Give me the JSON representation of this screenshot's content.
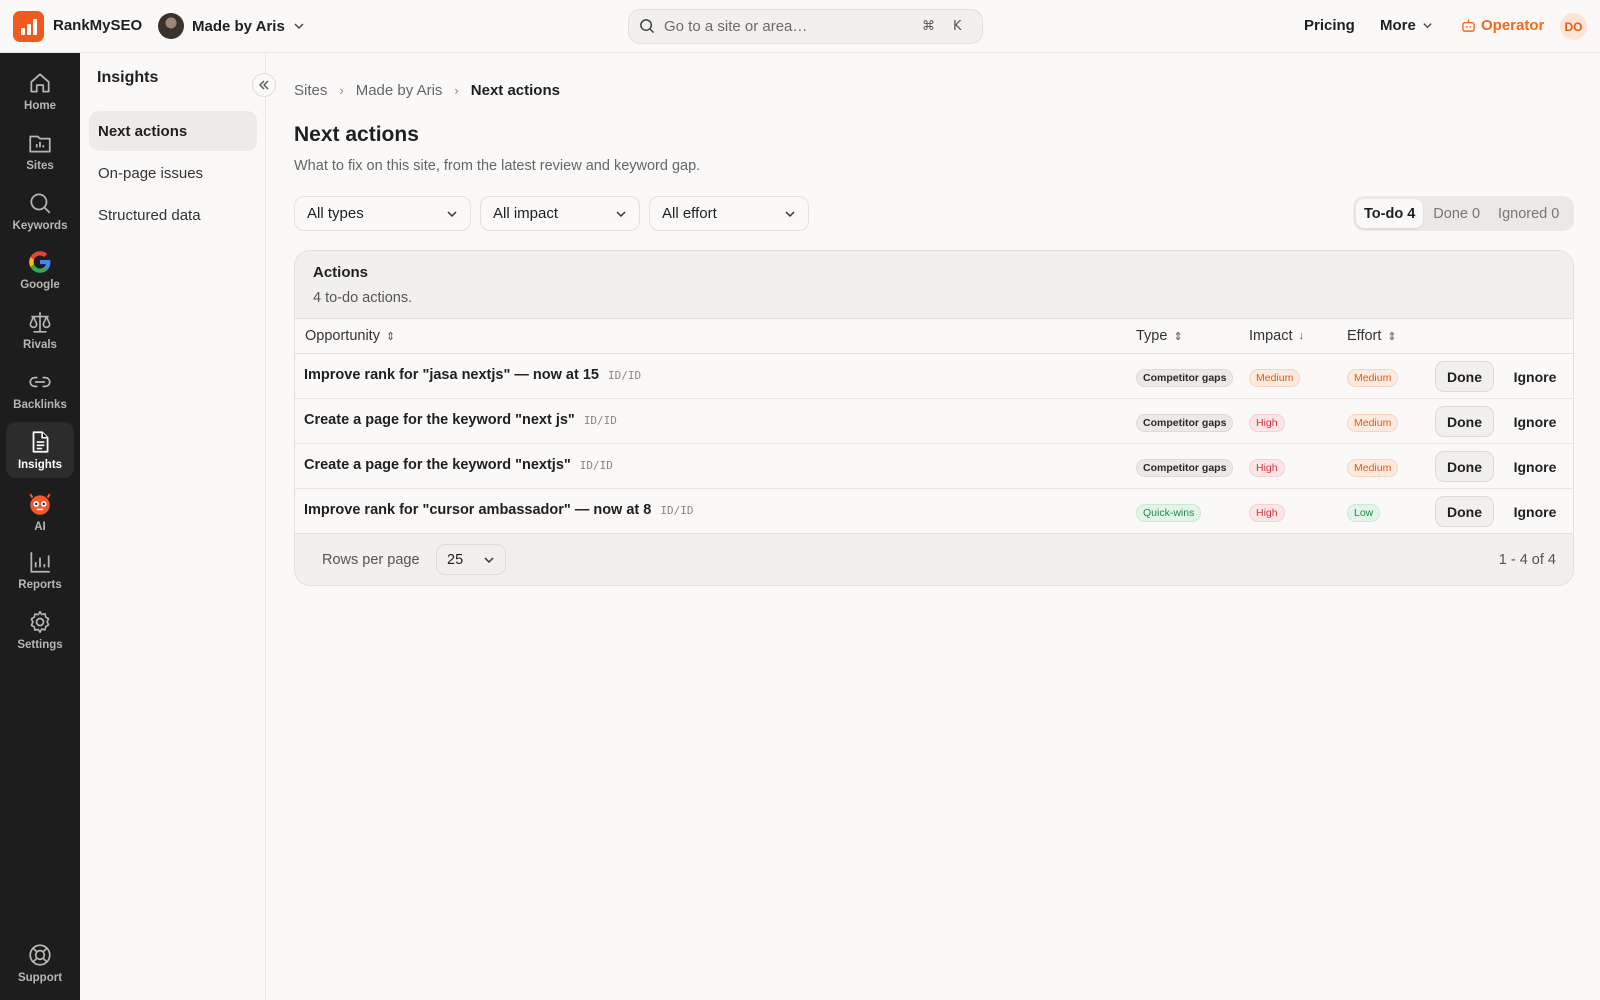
{
  "app": {
    "brand": "RankMySEO",
    "site": "Made by Aris",
    "search_placeholder": "Go to a site or area…",
    "shortcut_cmd": "⌘",
    "shortcut_key": "K",
    "nav_links": {
      "pricing": "Pricing",
      "more": "More",
      "operator": "Operator"
    },
    "user_initials": "DO",
    "colors": {
      "accent": "#f05a1e",
      "rail_bg": "#1d1d1d"
    }
  },
  "rail": {
    "items": [
      {
        "label": "Home",
        "icon": "home-icon"
      },
      {
        "label": "Sites",
        "icon": "sites-icon"
      },
      {
        "label": "Keywords",
        "icon": "search-icon"
      },
      {
        "label": "Google",
        "icon": "google-icon"
      },
      {
        "label": "Rivals",
        "icon": "scale-icon"
      },
      {
        "label": "Backlinks",
        "icon": "link-icon"
      },
      {
        "label": "Insights",
        "icon": "document-icon",
        "active": true
      },
      {
        "label": "AI",
        "icon": "robot-icon"
      },
      {
        "label": "Reports",
        "icon": "bar-chart-icon"
      },
      {
        "label": "Settings",
        "icon": "gear-icon"
      }
    ],
    "support": "Support"
  },
  "subnav": {
    "title": "Insights",
    "items": [
      {
        "label": "Next actions",
        "active": true
      },
      {
        "label": "On-page issues"
      },
      {
        "label": "Structured data"
      }
    ]
  },
  "main": {
    "breadcrumb": [
      "Sites",
      "Made by Aris",
      "Next actions"
    ],
    "title": "Next actions",
    "subtitle": "What to fix on this site, from the latest review and keyword gap.",
    "filters": [
      "All types",
      "All impact",
      "All effort"
    ],
    "segments": [
      "To-do 4",
      "Done 0",
      "Ignored 0"
    ],
    "card": {
      "title": "Actions",
      "subtitle": "4 to-do actions.",
      "columns": [
        "Opportunity",
        "Type",
        "Impact",
        "Effort"
      ],
      "rows": [
        {
          "opportunity": "Improve rank for \"jasa nextjs\" — now at 15",
          "code": "ID/ID",
          "type": "Competitor gaps",
          "impact": "Medium",
          "effort": "Medium"
        },
        {
          "opportunity": "Create a page for the keyword \"next js\"",
          "code": "ID/ID",
          "type": "Competitor gaps",
          "impact": "High",
          "effort": "Medium"
        },
        {
          "opportunity": "Create a page for the keyword \"nextjs\"",
          "code": "ID/ID",
          "type": "Competitor gaps",
          "impact": "High",
          "effort": "Medium"
        },
        {
          "opportunity": "Improve rank for \"cursor ambassador\" — now at 8",
          "code": "ID/ID",
          "type": "Quick-wins",
          "impact": "High",
          "effort": "Low"
        }
      ],
      "done_label": "Done",
      "ignore_label": "Ignore",
      "rows_per_page_label": "Rows per page",
      "rows_per_page": "25",
      "pagination": "1 - 4 of 4"
    }
  }
}
